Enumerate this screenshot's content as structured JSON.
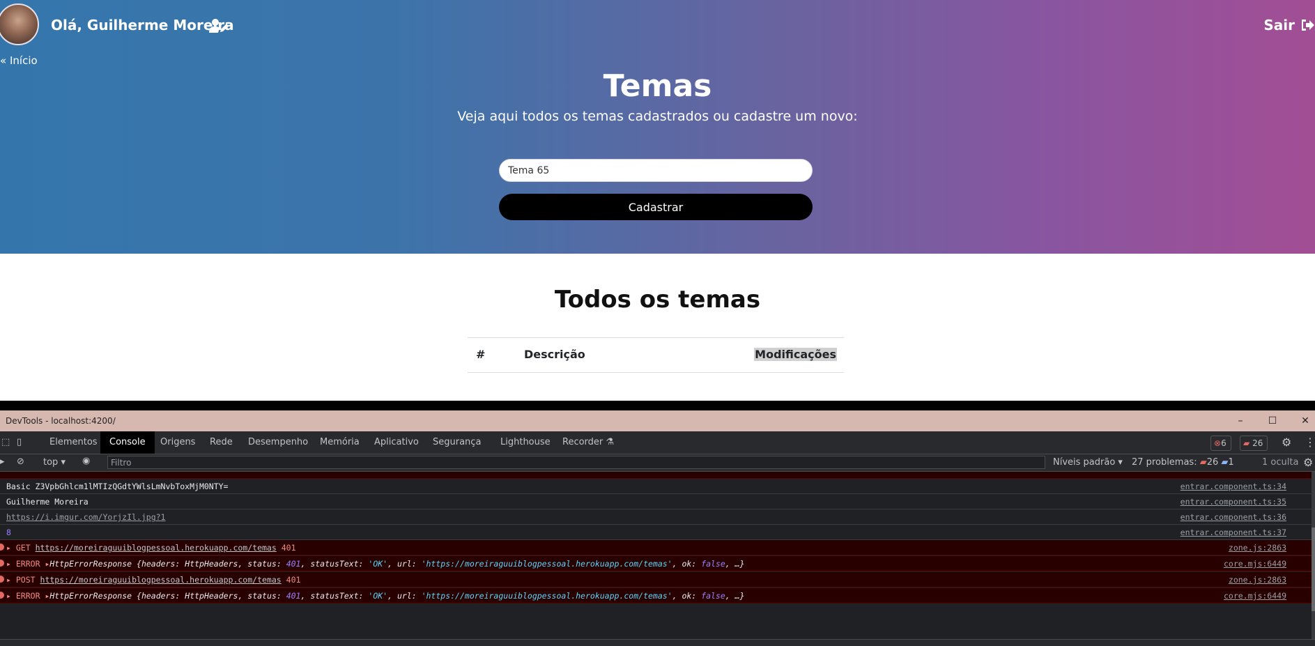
{
  "header": {
    "greeting": "Olá, Guilherme Moreira",
    "logout_label": "Sair",
    "back_label": "Início"
  },
  "hero": {
    "title": "Temas",
    "subtitle": "Veja aqui todos os temas cadastrados ou cadastre um novo:",
    "input_value": "Tema 65",
    "submit_label": "Cadastrar"
  },
  "content": {
    "title": "Todos os temas",
    "table_headers": [
      "#",
      "Descrição",
      "Modificações"
    ]
  },
  "devtools": {
    "title": "DevTools - localhost:4200/",
    "tabs": [
      "Elementos",
      "Console",
      "Origens",
      "Rede",
      "Desempenho",
      "Memória",
      "Aplicativo",
      "Segurança",
      "Lighthouse",
      "Recorder"
    ],
    "error_count": "6",
    "issue_count": "26",
    "context": "top",
    "filter_placeholder": "Filtro",
    "levels": "Níveis padrão",
    "problems": "27 problemas:",
    "problems_errors": "26",
    "problems_info": "1",
    "hidden": "1 oculta",
    "rows": [
      {
        "text": "Basic Z3VpbGhlcm1lMTIzQGdtYWlsLmNvbToxMjM0NTY=",
        "source": "entrar.component.ts:34"
      },
      {
        "text": "Guilherme Moreira",
        "source": "entrar.component.ts:35"
      },
      {
        "text": "https://i.imgur.com/YorjzIl.jpg?1",
        "source": "entrar.component.ts:36"
      },
      {
        "text": "8",
        "source": "entrar.component.ts:37"
      },
      {
        "method": "GET",
        "url": "https://moreiraguuiblogpessoal.herokuapp.com/temas",
        "status": "401",
        "source": "zone.js:2863"
      },
      {
        "label": "ERROR",
        "obj": "HttpErrorResponse",
        "source": "core.mjs:6449"
      },
      {
        "method": "POST",
        "url": "https://moreiraguuiblogpessoal.herokuapp.com/temas",
        "status": "401",
        "source": "zone.js:2863"
      },
      {
        "label": "ERROR",
        "obj": "HttpErrorResponse",
        "source": "core.mjs:6449"
      }
    ],
    "obj_tail": {
      "pre": "{headers: ",
      "headers": "HttpHeaders",
      "status_key": ", status: ",
      "status": "401",
      "st_key": ", statusText: ",
      "status_text": "'OK'",
      "url_key": ", url: ",
      "url": "'https://moreiraguuiblogpessoal.herokuapp.com/temas'",
      "ok_key": ", ok: ",
      "ok": "false",
      "end": ", …}"
    }
  }
}
